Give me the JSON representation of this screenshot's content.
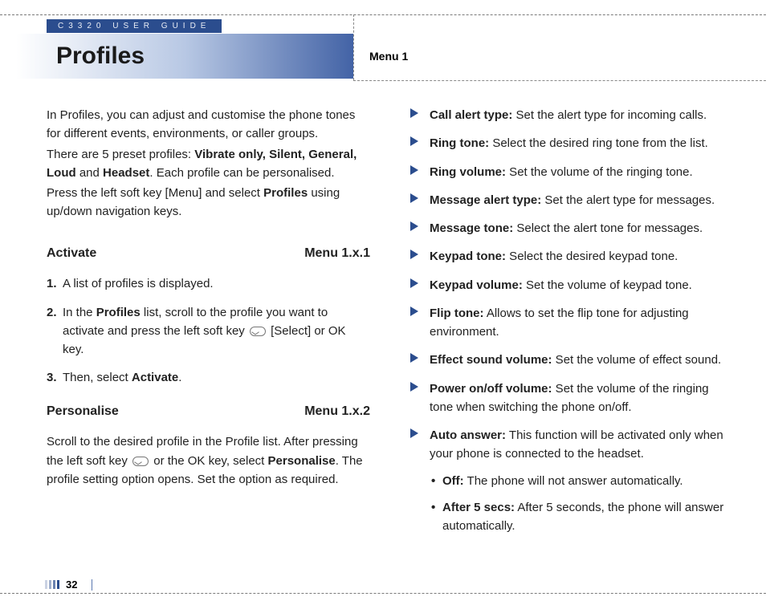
{
  "header": {
    "guide": "C3320 USER GUIDE",
    "title": "Profiles",
    "menu": "Menu 1"
  },
  "intro": {
    "p1": "In Profiles, you can adjust and customise the phone tones for different events, environments, or caller groups.",
    "p2a": "There are 5 preset profiles: ",
    "p2b_bold": "Vibrate only, Silent, General, Loud",
    "p2c": " and ",
    "p2d_bold": "Headset",
    "p2e": ". Each profile can be personalised.",
    "p3a": "Press the left soft key [Menu] and select ",
    "p3b_bold": "Profiles",
    "p3c": " using up/down navigation keys."
  },
  "activate": {
    "heading": "Activate",
    "menu": "Menu 1.x.1",
    "step1": "A list of profiles is displayed.",
    "step2a": "In the ",
    "step2b_bold": "Profiles",
    "step2c": " list, scroll to the profile you want to activate and press the left soft key ",
    "step2d": " [Select] or OK key.",
    "step3a": "Then, select ",
    "step3b_bold": "Activate",
    "step3c": "."
  },
  "personalise": {
    "heading": "Personalise",
    "menu": "Menu 1.x.2",
    "p1a": "Scroll to the desired profile in the Profile list. After pressing the left soft key ",
    "p1b": " or the OK key, select ",
    "p1c_bold": "Personalise",
    "p1d": ". The profile setting option opens. Set the option as required."
  },
  "options": [
    {
      "term": "Call alert type:",
      "desc": " Set the alert type for incoming calls."
    },
    {
      "term": "Ring tone:",
      "desc": " Select the desired ring tone from the list."
    },
    {
      "term": "Ring volume:",
      "desc": " Set the volume of the ringing tone."
    },
    {
      "term": "Message alert type:",
      "desc": " Set the alert type for messages."
    },
    {
      "term": "Message tone:",
      "desc": " Select the alert tone for messages."
    },
    {
      "term": "Keypad tone:",
      "desc": " Select the desired keypad tone."
    },
    {
      "term": "Keypad volume:",
      "desc": " Set the volume of keypad tone."
    },
    {
      "term": "Flip tone:",
      "desc": " Allows to set the flip tone for adjusting environment."
    },
    {
      "term": "Effect sound volume:",
      "desc": " Set the volume of effect sound."
    },
    {
      "term": "Power on/off volume:",
      "desc": " Set the volume of the ringing tone when switching the phone on/off."
    },
    {
      "term": "Auto answer:",
      "desc": " This function will be activated only when your phone is connected to the headset."
    }
  ],
  "auto_answer_sub": [
    {
      "term": "Off:",
      "desc": " The phone will not answer automatically."
    },
    {
      "term": "After 5 secs:",
      "desc": " After 5 seconds, the phone will answer automatically."
    }
  ],
  "page": "32"
}
